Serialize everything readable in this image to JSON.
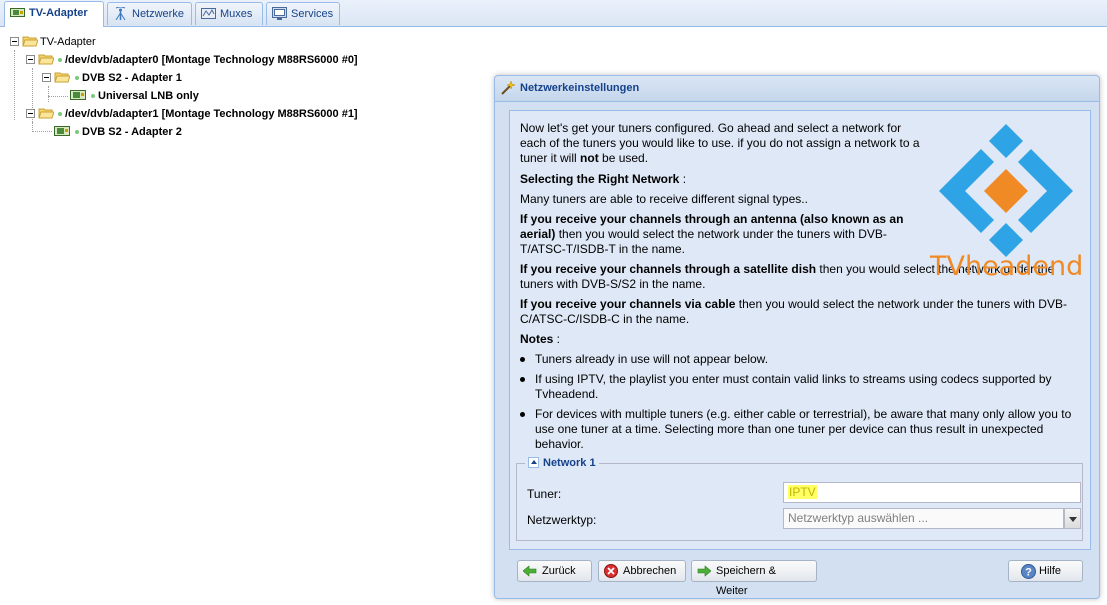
{
  "tabs": [
    {
      "label": "TV-Adapter",
      "icon": "tv-card-icon",
      "active": true
    },
    {
      "label": "Netzwerke",
      "icon": "antenna-icon"
    },
    {
      "label": "Muxes",
      "icon": "muxes-icon"
    },
    {
      "label": "Services",
      "icon": "services-icon"
    }
  ],
  "tree": {
    "root": "TV-Adapter",
    "adapter0": "/dev/dvb/adapter0 [Montage Technology M88RS6000 #0]",
    "frontend1": "DVB S2 - Adapter 1",
    "lnb": "Universal LNB only",
    "adapter1": "/dev/dvb/adapter1 [Montage Technology M88RS6000 #1]",
    "frontend2": "DVB S2 - Adapter 2"
  },
  "dialog": {
    "title": "Netzwerkeinstellungen",
    "intro_pre": "Now let's get your tuners configured. Go ahead and select a network for each of the tuners you would like to use. if you do not assign a network to a tuner it will ",
    "intro_bold": "not",
    "intro_post": " be used.",
    "selecting_heading": "Selecting the Right Network",
    "selecting_colon": " :",
    "many_tuners": "Many tuners are able to receive different signal types..",
    "antenna_bold": "If you receive your channels through an antenna (also known as an aerial)",
    "antenna_rest": " then you would select the network under the tuners with DVB-T/ATSC-T/ISDB-T in the name.",
    "satellite_bold": "If you receive your channels through a satellite dish",
    "satellite_rest": " then you would select the network under the tuners with DVB-S/S2 in the name.",
    "cable_bold": "If you receive your channels via cable",
    "cable_rest": " then you would select the network under the tuners with DVB-C/ATSC-C/ISDB-C in the name.",
    "notes_heading": "Notes",
    "notes_colon": " :",
    "notes": [
      "Tuners already in use will not appear below.",
      "If using IPTV, the playlist you enter must contain valid links to streams using codecs supported by Tvheadend.",
      "For devices with multiple tuners (e.g. either cable or terrestrial), be aware that many only allow you to use one tuner at a time. Selecting more than one tuner per device can thus result in unexpected behavior."
    ],
    "logo_text": "TVheadend",
    "network": {
      "legend": "Network 1",
      "tuner_label": "Tuner:",
      "tuner_value": "IPTV",
      "type_label": "Netzwerktyp:",
      "type_placeholder": "Netzwerktyp auswählen ..."
    },
    "buttons": {
      "back": "Zurück",
      "cancel": "Abbrechen",
      "save_next": "Speichern & Weiter",
      "help": "Hilfe"
    }
  },
  "colors": {
    "logo_blue": "#2ea3e6",
    "logo_orange": "#f08a24",
    "header_text": "#15428b",
    "highlight": "#ffff66"
  }
}
